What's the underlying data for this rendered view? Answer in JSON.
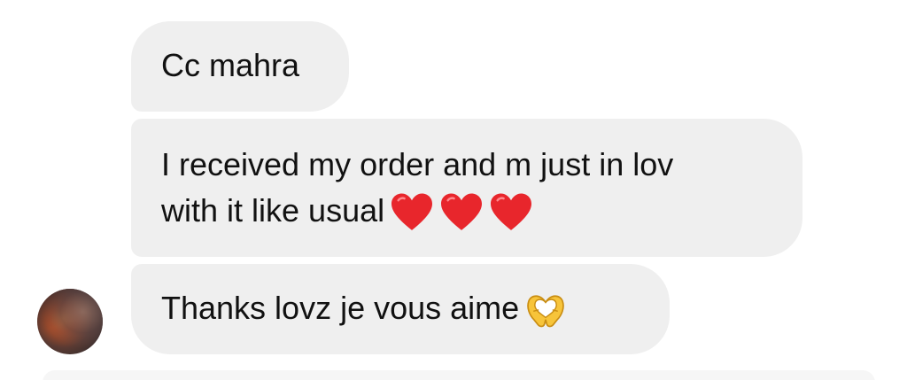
{
  "messages": [
    {
      "lines": [
        "Cc mahra"
      ]
    },
    {
      "lines": [
        "I received my order and m just in lov",
        "with it like usual"
      ],
      "emoji": [
        "heart-icon",
        "heart-icon",
        "heart-icon"
      ]
    },
    {
      "lines": [
        "Thanks lovz je vous aime"
      ],
      "emoji": [
        "heart-hands-icon"
      ]
    }
  ],
  "colors": {
    "bubble": "#efefef",
    "text": "#111111",
    "heart": "#e8262c",
    "hands": "#f7c43a"
  },
  "sender": {
    "avatar": "avatar"
  }
}
